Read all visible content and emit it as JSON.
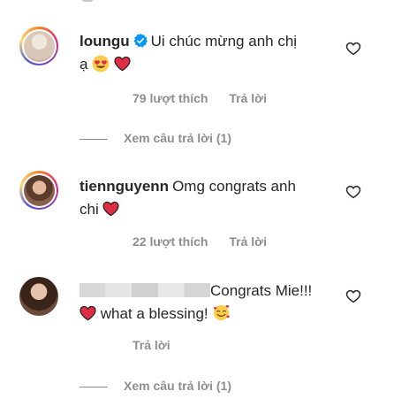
{
  "comments": [
    {
      "username": "loungu",
      "verified": true,
      "text_part1": "Ui chúc mừng anh chị",
      "text_part2": "ạ",
      "likes_label": "79 lượt thích",
      "reply_label": "Trả lời",
      "view_replies_label": "Xem câu trả lời (1)",
      "avatar_color": "#d9c7b8"
    },
    {
      "username": "tiennguyenn",
      "verified": false,
      "text_part1": "Omg congrats anh",
      "text_part2": "chi",
      "likes_label": "22 lượt thích",
      "reply_label": "Trả lời",
      "avatar_color": "#a0765c"
    },
    {
      "username_redacted": true,
      "text_part1": "Congrats Mie!!!",
      "text_part2": "what a blessing!",
      "reply_label": "Trả lời",
      "view_replies_label": "Xem câu trả lời (1)",
      "avatar_color": "#6b4a3a"
    }
  ],
  "colors": {
    "text": "#262626",
    "secondary": "#8e8e8e",
    "heart_red": "#ed4956",
    "verified_blue": "#0095f6"
  },
  "icons": [
    "heart-outline-icon",
    "verified-badge-icon",
    "red-heart-emoji",
    "heart-eyes-emoji",
    "smiling-face-with-hearts-emoji"
  ]
}
